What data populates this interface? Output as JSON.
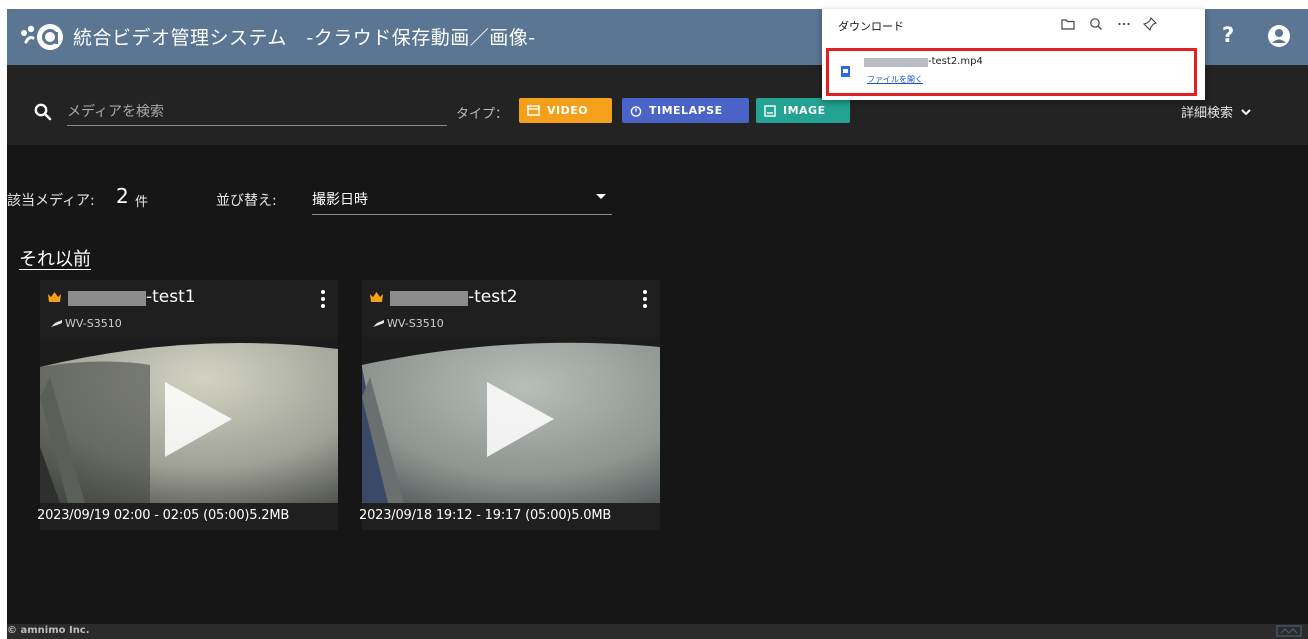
{
  "header": {
    "title": "統合ビデオ管理システム　-クラウド保存動画／画像-",
    "help_label": "?"
  },
  "search": {
    "placeholder": "メディアを検索",
    "type_label": "タイプ：",
    "chips": {
      "video": "VIDEO",
      "timelapse": "TIMELAPSE",
      "image": "IMAGE"
    },
    "advanced_label": "詳細検索"
  },
  "results": {
    "count_label": "該当メディア:",
    "count": "2",
    "count_unit": "件",
    "sort_label": "並び替え:",
    "sort_value": "撮影日時"
  },
  "section_title": "それ以前",
  "cards": [
    {
      "name_suffix": "-test1",
      "device": "WV-S3510",
      "info": "2023/09/19 02:00 - 02:05 (05:00)5.2MB"
    },
    {
      "name_suffix": "-test2",
      "device": "WV-S3510",
      "info": "2023/09/18 19:12 - 19:17 (05:00)5.0MB"
    }
  ],
  "footer": {
    "copyright": "© amnimo Inc."
  },
  "download_panel": {
    "title": "ダウンロード",
    "file_suffix": "-test2.mp4",
    "open_link": "ファイルを開く"
  },
  "colors": {
    "header_bg": "#5b7692",
    "video_chip": "#f5a01a",
    "timelapse_chip": "#4a63c8",
    "image_chip": "#23a393",
    "highlight_border": "#e02020"
  }
}
